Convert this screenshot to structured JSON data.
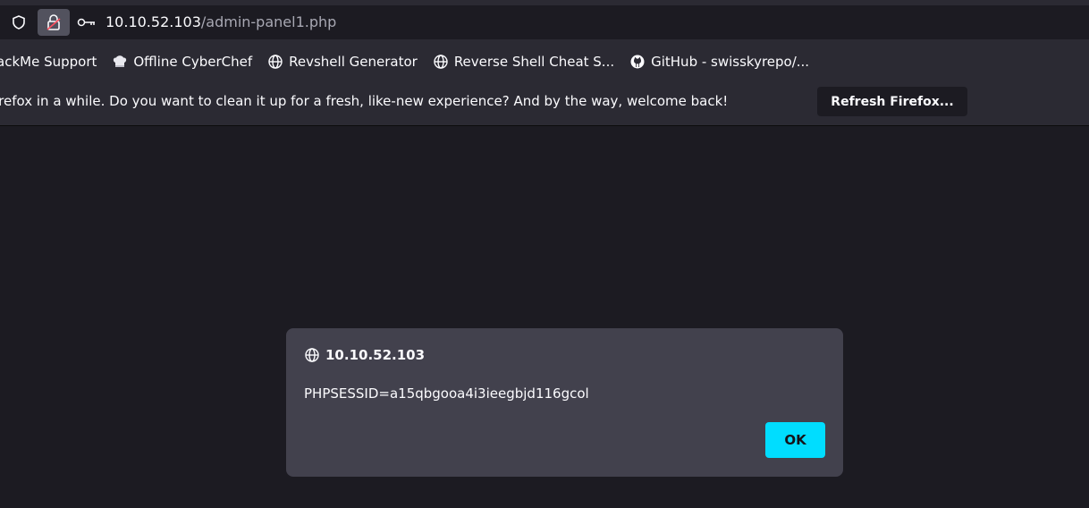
{
  "urlbar": {
    "host": "10.10.52.103",
    "path": "/admin-panel1.php",
    "icons": [
      "shield-icon",
      "lock-icon",
      "key-icon"
    ]
  },
  "bookmarks": [
    {
      "label": "ackMe Support",
      "icon": "none"
    },
    {
      "label": "Offline CyberChef",
      "icon": "chef-hat-icon"
    },
    {
      "label": "Revshell Generator",
      "icon": "globe-icon"
    },
    {
      "label": "Reverse Shell Cheat S...",
      "icon": "globe-icon"
    },
    {
      "label": "GitHub - swisskyrepo/...",
      "icon": "github-icon"
    }
  ],
  "notification": {
    "text": "irefox in a while. Do you want to clean it up for a fresh, like-new experience? And by the way, welcome back!",
    "button_label": "Refresh Firefox..."
  },
  "dialog": {
    "title": "10.10.52.103",
    "message": "PHPSESSID=a15qbgooa4i3ieegbjd116gcol",
    "ok_label": "OK"
  },
  "colors": {
    "accent": "#00ddff",
    "page_bg": "#1c1b22",
    "toolbar_bg": "#2b2a33",
    "dialog_bg": "#42414d"
  }
}
